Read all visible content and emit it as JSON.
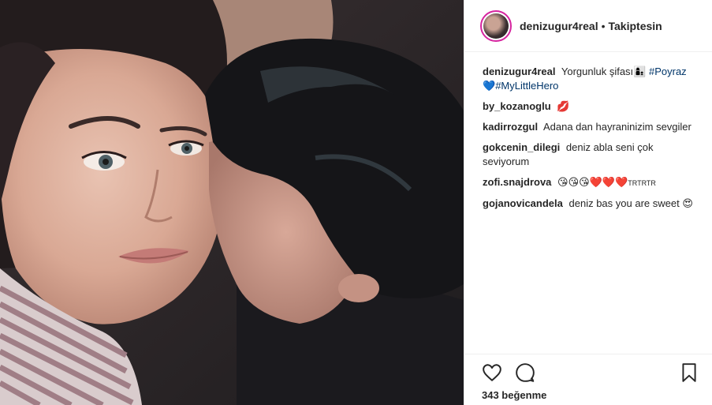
{
  "header": {
    "username": "denizugur4real",
    "separator": "•",
    "follow_status": "Takiptesin"
  },
  "caption": {
    "username": "denizugur4real",
    "text": "Yorgunluk şifası",
    "emoji_1": "👩‍👦",
    "hashtag_1": "#Poyraz",
    "emoji_2": "💙",
    "hashtag_2": "#MyLittleHero"
  },
  "comments": [
    {
      "username": "by_kozanoglu",
      "text": "",
      "emoji": "💋"
    },
    {
      "username": "kadirrozgul",
      "text": "Adana dan hayraninizim sevgiler",
      "emoji": ""
    },
    {
      "username": "gokcenin_dilegi",
      "text": "deniz abla seni çok seviyorum",
      "emoji": ""
    },
    {
      "username": "zofi.snajdrova",
      "text": "",
      "emoji": "😘😘😘❤️❤️❤️",
      "suffix": "TRTRTR"
    },
    {
      "username": "gojanovicandela",
      "text": "deniz bas you are sweet",
      "emoji": "😍"
    }
  ],
  "actions": {
    "like_icon": "heart-outline-icon",
    "comment_icon": "comment-bubble-icon",
    "save_icon": "bookmark-icon"
  },
  "likes": {
    "text": "343 beğenme"
  },
  "colors": {
    "text": "#262626",
    "hashtag": "#003569",
    "border": "#efefef",
    "story_ring": "#d6249f"
  }
}
